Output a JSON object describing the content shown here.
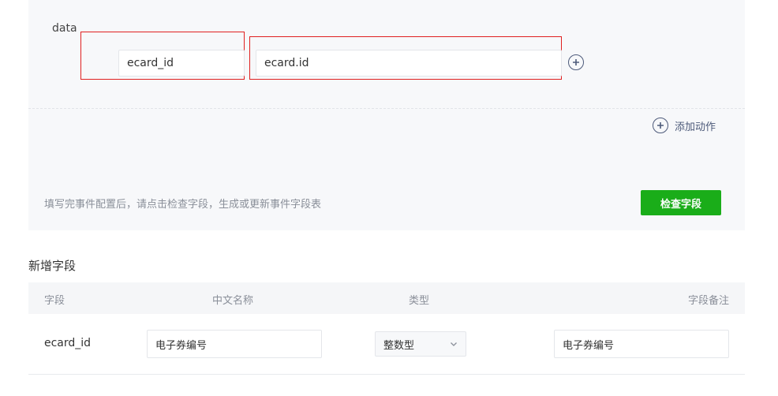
{
  "event_config": {
    "data_label": "data",
    "param_key_value": "ecard_id",
    "param_value_value": "ecard.id",
    "add_action_label": "添加动作",
    "hint_text": "填写完事件配置后，请点击检查字段，生成或更新事件字段表",
    "check_fields_button": "检查字段"
  },
  "new_fields": {
    "title": "新增字段",
    "columns": [
      "字段",
      "中文名称",
      "类型",
      "字段备注"
    ],
    "rows": [
      {
        "field": "ecard_id",
        "chinese_name": "电子券编号",
        "type": "整数型",
        "remark": "电子券编号"
      }
    ]
  },
  "colors": {
    "primary_green": "#1aad19",
    "highlight_red": "#e02020",
    "icon_blue": "#4d5a7a"
  },
  "icons": [
    "plus-circle-icon",
    "chevron-down-icon"
  ]
}
